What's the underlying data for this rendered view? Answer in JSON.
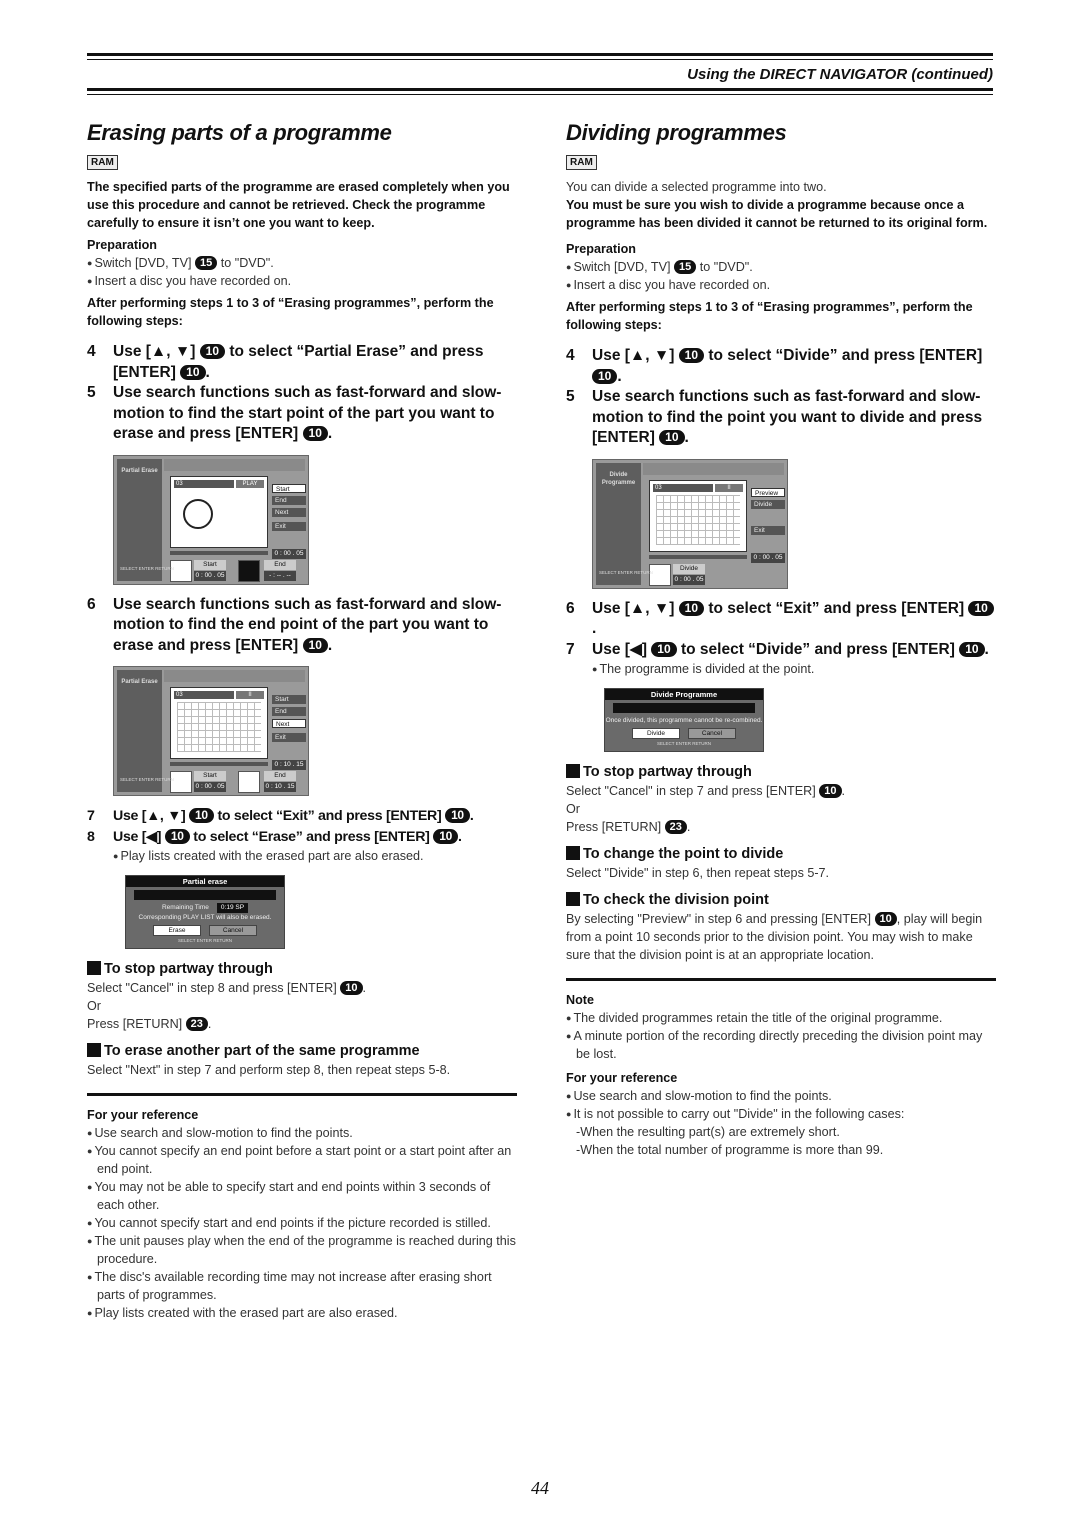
{
  "header": {
    "title": "Using the DIRECT NAVIGATOR (continued)"
  },
  "left": {
    "title": "Erasing parts of a programme",
    "badge": "RAM",
    "warning": "The specified parts of the programme are erased completely when you use this procedure and cannot be retrieved. Check the programme carefully to ensure it isn’t one you want to keep.",
    "prep_head": "Preparation",
    "prep1_a": "Switch [DVD, TV]",
    "prep1_badge": "15",
    "prep1_b": "to \"DVD\".",
    "prep2": "Insert a disc you have recorded on.",
    "after": "After performing steps 1 to 3 of “Erasing programmes”, perform the following steps:",
    "step4": {
      "num": "4",
      "a": "Use [▲, ▼]",
      "badge": "10",
      "b": "to select “Partial Erase” and press [ENTER]",
      "c": "."
    },
    "step5": {
      "num": "5",
      "a": "Use search functions such as fast-forward and slow-motion to find the start point of the part you want to erase and press [ENTER]",
      "badge": "10",
      "b": "."
    },
    "screen1": {
      "side": "Partial Erase",
      "prog": "03",
      "state": "PLAY",
      "menu": [
        "Start",
        "End",
        "Next",
        "Exit"
      ],
      "selected": 0,
      "time": "0 : 00 . 05",
      "start_label": "Start",
      "start_val": "0 : 00 . 05",
      "end_label": "End",
      "end_val": "- : -- . --",
      "nav": "SELECT ENTER RETURN"
    },
    "step6": {
      "num": "6",
      "a": "Use search functions such as fast-forward and slow-motion to find the end point of the part you want to erase and press [ENTER]",
      "badge": "10",
      "b": "."
    },
    "screen2": {
      "side": "Partial Erase",
      "prog": "03",
      "state": "II",
      "menu": [
        "Start",
        "End",
        "Next",
        "Exit"
      ],
      "selected": 2,
      "time": "0 : 10 . 15",
      "start_label": "Start",
      "start_val": "0 : 00 . 05",
      "end_label": "End",
      "end_val": "0 : 10 . 15",
      "nav": "SELECT ENTER RETURN"
    },
    "step7": {
      "num": "7",
      "a": "Use [▲, ▼]",
      "badge": "10",
      "b": "to select “Exit” and press [ENTER]",
      "c": "."
    },
    "step8": {
      "num": "8",
      "a": "Use [◀]",
      "badge": "10",
      "b": "to select “Erase” and press [ENTER]",
      "c": "."
    },
    "step8_note": "Play lists created with the erased part are also erased.",
    "dialog": {
      "title": "Partial erase",
      "remaining_label": "Remaining Time",
      "remaining_val": "0:19  SP",
      "msg": "Corresponding PLAY LIST will also be erased.",
      "btn1": "Erase",
      "btn2": "Cancel",
      "nav": "SELECT  ENTER  RETURN"
    },
    "stop_head": "To stop partway through",
    "stop_a": "Select \"Cancel\" in step 8 and press [ENTER]",
    "stop_badge": "10",
    "stop_b": ".",
    "stop_or": "Or",
    "stop_c": "Press [RETURN]",
    "stop_badge2": "23",
    "stop_d": ".",
    "another_head": "To erase another part of the same programme",
    "another_text": "Select \"Next\" in step 7 and perform step 8, then repeat steps 5-8.",
    "ref_head": "For your reference",
    "ref": [
      "Use search and slow-motion to find the points.",
      "You cannot specify an end point before a start point or a start point after an end point.",
      "You may not be able to specify start and end points within 3 seconds of each other.",
      "You cannot specify start and end points if the picture recorded is stilled.",
      "The unit pauses play when the end of the programme is reached during this procedure.",
      "The disc's available recording time may not increase after erasing short parts of programmes.",
      "Play lists created with the erased part are also erased."
    ]
  },
  "right": {
    "title": "Dividing programmes",
    "badge": "RAM",
    "intro": "You can divide a selected programme into two.",
    "warning": "You must be sure you wish to divide a programme because once a programme has been divided it cannot be returned to its original form.",
    "prep_head": "Preparation",
    "prep1_a": "Switch [DVD, TV]",
    "prep1_badge": "15",
    "prep1_b": "to \"DVD\".",
    "prep2": "Insert a disc you have recorded on.",
    "after": "After performing steps 1 to 3 of “Erasing programmes”, perform the following steps:",
    "step4": {
      "num": "4",
      "a": "Use [▲, ▼]",
      "badge": "10",
      "b": "to select “Divide” and press [ENTER]",
      "c": "."
    },
    "step5": {
      "num": "5",
      "a": "Use search functions such as fast-forward and slow-motion to find the point you want to divide and press [ENTER]",
      "badge": "10",
      "b": "."
    },
    "screen": {
      "side": "Divide Programme",
      "prog": "03",
      "state": "II",
      "menu": [
        "Preview",
        "Divide",
        "Exit"
      ],
      "selected": 0,
      "time": "0 : 00 . 05",
      "div_label": "Divide",
      "div_val": "0 : 00 . 05",
      "nav": "SELECT ENTER RETURN"
    },
    "step6": {
      "num": "6",
      "a": "Use [▲, ▼]",
      "badge": "10",
      "b": "to select “Exit” and press [ENTER]",
      "c": "."
    },
    "step7": {
      "num": "7",
      "a": "Use [◀]",
      "badge": "10",
      "b": "to select “Divide” and press [ENTER]",
      "c": "."
    },
    "step7_note": "The programme is divided at the point.",
    "dialog": {
      "title": "Divide Programme",
      "msg": "Once divided, this programme cannot be re-combined.",
      "btn1": "Divide",
      "btn2": "Cancel",
      "nav": "SELECT  ENTER  RETURN"
    },
    "stop_head": "To stop partway through",
    "stop_a": "Select \"Cancel\" in step 7 and press [ENTER]",
    "stop_badge": "10",
    "stop_b": ".",
    "stop_or": "Or",
    "stop_c": "Press [RETURN]",
    "stop_badge2": "23",
    "stop_d": ".",
    "change_head": "To change the point to divide",
    "change_text": "Select \"Divide\" in step 6, then repeat steps 5-7.",
    "check_head": "To check the division point",
    "check_a": "By selecting \"Preview\" in step 6 and pressing [ENTER]",
    "check_badge": "10",
    "check_b": ", play will begin from a point 10 seconds prior to the division point. You may wish to make sure that the division point is at an appropriate location.",
    "note_head": "Note",
    "notes": [
      "The divided programmes retain the title of the original programme.",
      "A minute portion of the recording directly preceding the division point may be lost."
    ],
    "ref_head": "For your reference",
    "ref": [
      "Use search and slow-motion to find the points.",
      "It is not possible to carry out \"Divide\" in the following cases:"
    ],
    "ref_sub": [
      "-When the resulting part(s) are extremely short.",
      "-When the total number of programme is more than 99."
    ]
  },
  "footer": {
    "page": "44"
  }
}
